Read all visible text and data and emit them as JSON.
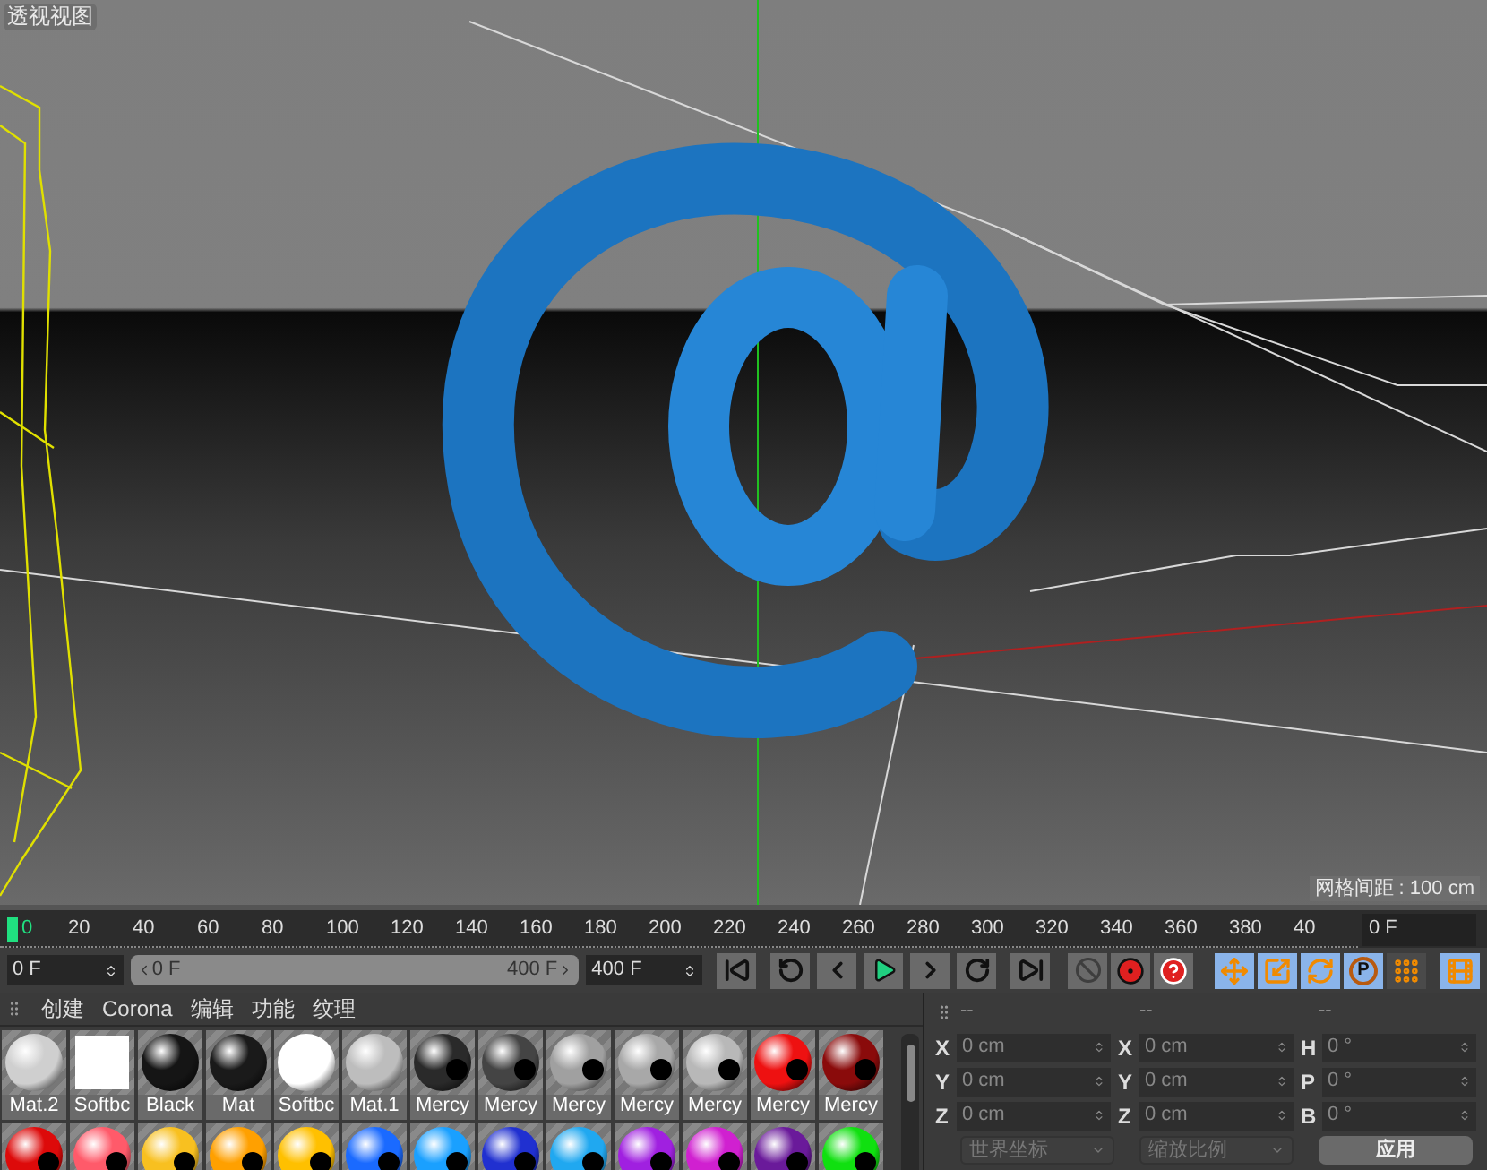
{
  "viewport": {
    "title": "透视视图",
    "grid_spacing": "网格间距 : 100 cm"
  },
  "timeline": {
    "ticks": [
      "0",
      "20",
      "40",
      "60",
      "80",
      "100",
      "120",
      "140",
      "160",
      "180",
      "200",
      "220",
      "240",
      "260",
      "280",
      "300",
      "320",
      "340",
      "360",
      "380",
      "40"
    ],
    "level": 0,
    "current_frame": "0 F"
  },
  "range": {
    "level": 1,
    "start_field": "0 F",
    "min": "0 F",
    "max": "400 F",
    "end_field": "400 F"
  },
  "transport": [
    {
      "kind": "first"
    },
    {
      "kind": "prev-key"
    },
    {
      "kind": "prev-frame"
    },
    {
      "kind": "play"
    },
    {
      "kind": "next-frame"
    },
    {
      "kind": "next-key"
    },
    {
      "kind": "last"
    }
  ],
  "keys": [
    {
      "kind": "off"
    },
    {
      "kind": "record"
    },
    {
      "kind": "help"
    }
  ],
  "tools": [
    {
      "kind": "move",
      "selected": true
    },
    {
      "kind": "scale",
      "selected": true
    },
    {
      "kind": "rotate",
      "selected": true
    },
    {
      "kind": "param",
      "label": "P",
      "selected": true
    },
    {
      "kind": "points",
      "selected": false
    },
    {
      "kind": "timeline",
      "selected": true
    }
  ],
  "material_menu": [
    "创建",
    "Corona",
    "编辑",
    "功能",
    "纹理"
  ],
  "materials": [
    {
      "name": "Mat.2",
      "color": "#cfcfcf",
      "kind": "matte"
    },
    {
      "name": "Softbc",
      "color": "#ffffff",
      "kind": "flat"
    },
    {
      "name": "Black",
      "color": "#151515",
      "kind": "glossy"
    },
    {
      "name": "Mat",
      "color": "#1a1a1a",
      "kind": "glossy"
    },
    {
      "name": "Softbc",
      "color": "#ffffff",
      "kind": "glossy"
    },
    {
      "name": "Mat.1",
      "color": "#bdbdbd",
      "kind": "matte"
    },
    {
      "name": "Mercy",
      "color": "#2a2a2a",
      "kind": "mercy"
    },
    {
      "name": "Mercy",
      "color": "#444444",
      "kind": "mercy"
    },
    {
      "name": "Mercy",
      "color": "#a0a0a0",
      "kind": "mercy"
    },
    {
      "name": "Mercy",
      "color": "#a8a8a8",
      "kind": "mercy"
    },
    {
      "name": "Mercy",
      "color": "#b8b8b8",
      "kind": "mercy"
    },
    {
      "name": "Mercy",
      "color": "#ee1111",
      "kind": "mercy"
    },
    {
      "name": "Mercy",
      "color": "#8a0b0b",
      "kind": "mercy"
    }
  ],
  "materials_row_2": [
    {
      "color": "#dd0a0a"
    },
    {
      "color": "#ff5a6a"
    },
    {
      "color": "#f8c020"
    },
    {
      "color": "#ffa000"
    },
    {
      "color": "#ffc000"
    },
    {
      "color": "#1a6aff"
    },
    {
      "color": "#1aa0ff"
    },
    {
      "color": "#2030d0"
    },
    {
      "color": "#20a8f0"
    },
    {
      "color": "#a020e0"
    },
    {
      "color": "#d020d0"
    },
    {
      "color": "#6a1a9a"
    },
    {
      "color": "#10e010"
    }
  ],
  "coordinates": {
    "headers": [
      "--",
      "--",
      "--"
    ],
    "rows": [
      {
        "axes": [
          "X",
          "X",
          "H"
        ],
        "values": [
          "0 cm",
          "0 cm",
          "0 °"
        ]
      },
      {
        "axes": [
          "Y",
          "Y",
          "P"
        ],
        "values": [
          "0 cm",
          "0 cm",
          "0 °"
        ]
      },
      {
        "axes": [
          "Z",
          "Z",
          "B"
        ],
        "values": [
          "0 cm",
          "0 cm",
          "0 °"
        ]
      }
    ],
    "dropdowns": [
      "世界坐标",
      "缩放比例"
    ],
    "apply": "应用"
  }
}
